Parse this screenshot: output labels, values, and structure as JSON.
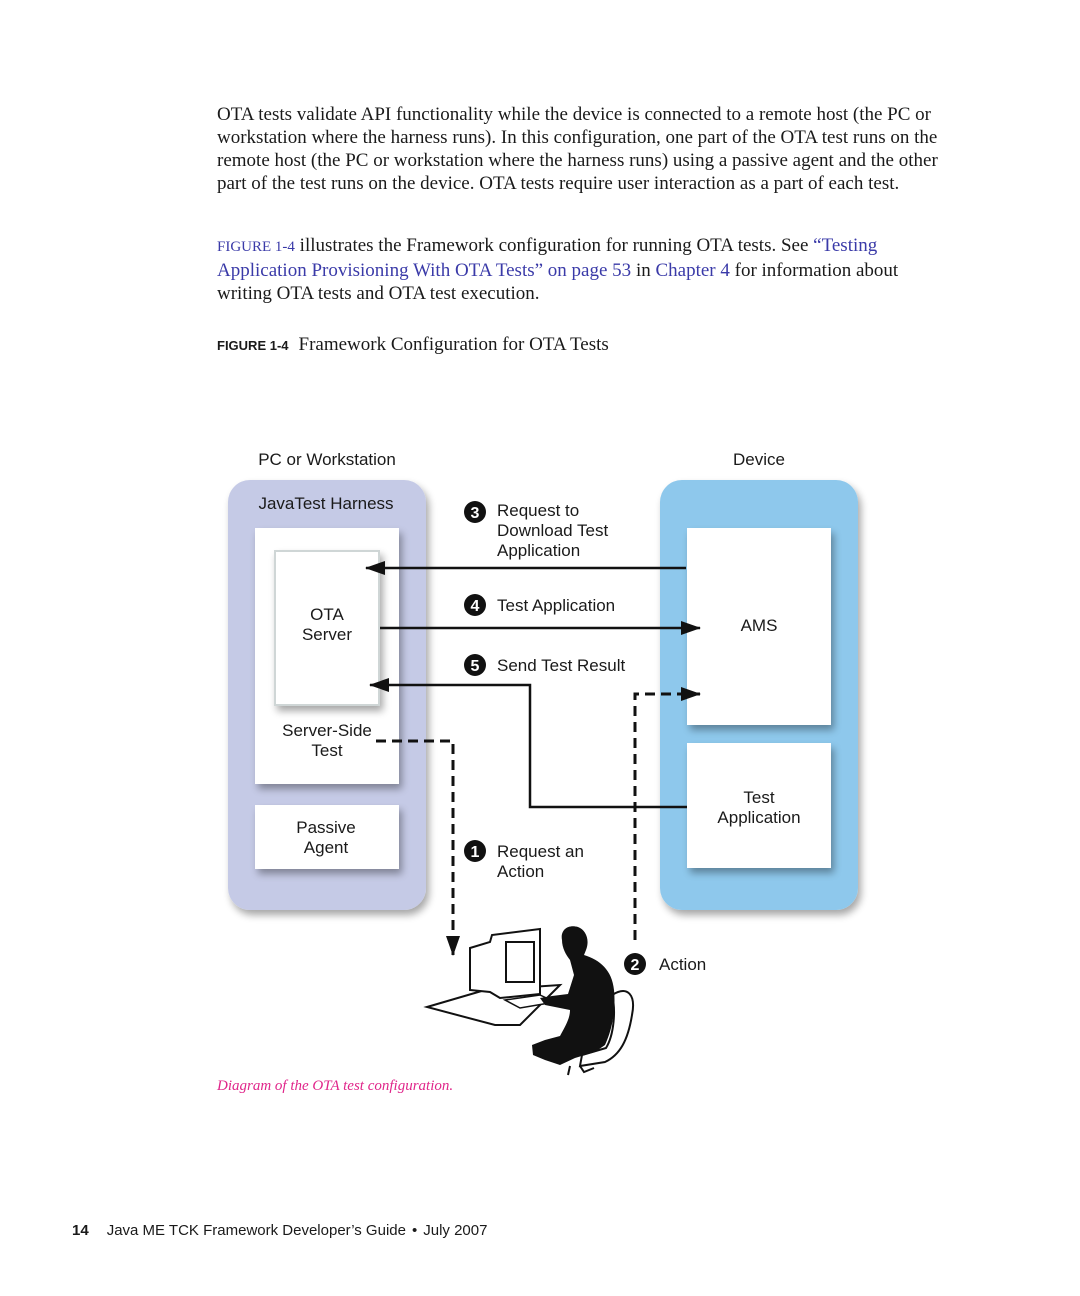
{
  "body": {
    "paragraph1": "OTA tests validate API functionality while the device is connected to a remote host (the PC or workstation where the harness runs). In this configuration, one part of the OTA test runs on the remote host (the PC or workstation where the harness runs) using a passive agent and the other part of the test runs on the device. OTA tests require user interaction as a part of each test.",
    "paragraph2": {
      "figure_ref": "FIGURE 1-4",
      "text_a": " illustrates the Framework configuration for running OTA tests. See ",
      "section_link": "“Testing Application Provisioning With OTA Tests” on page 53",
      "text_b": " in ",
      "chapter_link": "Chapter 4",
      "text_c": " for information about writing OTA tests and OTA test execution."
    }
  },
  "figure": {
    "label": "FIGURE 1-4",
    "title": "Framework Configuration for OTA Tests",
    "caption": "Diagram of the OTA test configuration.",
    "colors": {
      "harness_panel": "#c5cae6",
      "device_panel": "#8ec8ec",
      "caption": "#e0258a",
      "link": "#3a3aa8"
    },
    "left_heading": "PC or Workstation",
    "right_heading": "Device",
    "harness_label": "JavaTest Harness",
    "ota_server": [
      "OTA",
      "Server"
    ],
    "server_side_test": [
      "Server-Side",
      "Test"
    ],
    "passive_agent": [
      "Passive",
      "Agent"
    ],
    "ams": "AMS",
    "test_application": [
      "Test",
      "Application"
    ],
    "steps": [
      {
        "num": "1",
        "lines": [
          "Request an",
          "Action"
        ]
      },
      {
        "num": "2",
        "lines": [
          "Action"
        ]
      },
      {
        "num": "3",
        "lines": [
          "Request to",
          "Download Test",
          "Application"
        ]
      },
      {
        "num": "4",
        "lines": [
          "Test Application"
        ]
      },
      {
        "num": "5",
        "lines": [
          "Send Test Result"
        ]
      }
    ]
  },
  "footer": {
    "page_number": "14",
    "book_title": "Java ME TCK Framework Developer’s Guide",
    "separator": "•",
    "date": "July 2007"
  }
}
